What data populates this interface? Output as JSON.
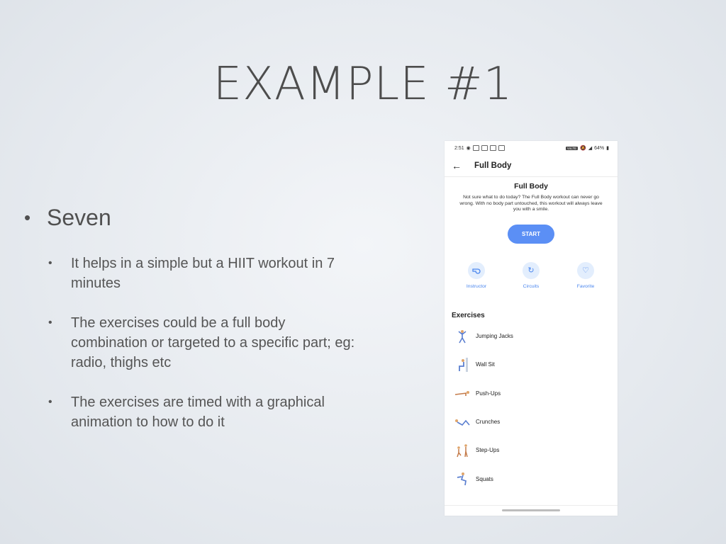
{
  "slide": {
    "title": "EXAMPLE #1",
    "bullet": "Seven",
    "sub_bullets": [
      "It helps in a simple but a HIIT workout in 7 minutes",
      "The exercises could be a full body combination or targeted to a specific part; eg: radio, thighs etc",
      "The exercises are timed with a graphical animation to how to do it"
    ]
  },
  "phone": {
    "status": {
      "time": "2:51",
      "battery": "64%",
      "volte": "VoLTE"
    },
    "app_bar_title": "Full Body",
    "workout_title": "Full Body",
    "description": "Not sure what to do today? The Full Body workout can never go wrong. With no body part untouched, this workout will always leave you with a smile.",
    "start_label": "START",
    "actions": [
      {
        "label": "Instructor",
        "icon": "whistle-icon"
      },
      {
        "label": "Circuits",
        "icon": "refresh-icon"
      },
      {
        "label": "Favorite",
        "icon": "heart-icon"
      }
    ],
    "exercises_header": "Exercises",
    "exercises": [
      {
        "label": "Jumping Jacks",
        "icon": "jumping-jacks-figure-icon"
      },
      {
        "label": "Wall Sit",
        "icon": "wall-sit-figure-icon"
      },
      {
        "label": "Push-Ups",
        "icon": "push-ups-figure-icon"
      },
      {
        "label": "Crunches",
        "icon": "crunches-figure-icon"
      },
      {
        "label": "Step-Ups",
        "icon": "step-ups-figure-icon"
      },
      {
        "label": "Squats",
        "icon": "squats-figure-icon"
      }
    ],
    "colors": {
      "accent": "#5b8ff5",
      "action_bg": "#e3eefd",
      "action_text": "#4a86ee"
    }
  }
}
